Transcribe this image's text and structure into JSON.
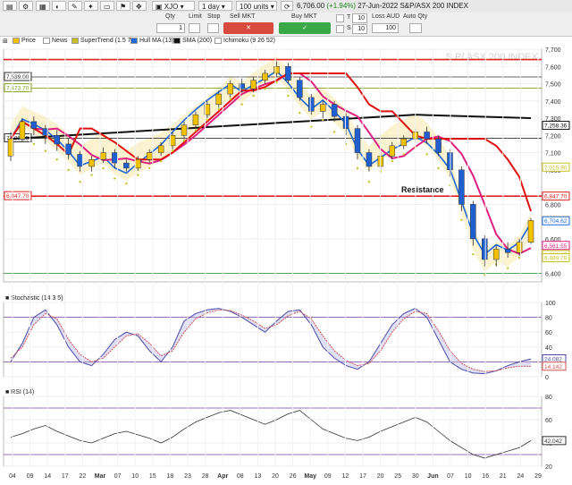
{
  "toolbar": {
    "symbol": "XJO",
    "period": "1 day",
    "units": "100 units",
    "last_price": "6,706.00",
    "change": "(+1.94%)",
    "date": "27-Jun-2022",
    "index_name": "S&P/ASX 200 INDEX"
  },
  "order_bar": {
    "qty_label": "Qty",
    "qty_value": "1",
    "limit_label": "Limit",
    "stop_label": "Stop",
    "sell_label": "Sell MKT",
    "buy_label": "Buy MKT",
    "t_label": "T",
    "s_label": "S",
    "t_value": "10",
    "s_value": "10",
    "loss_label": "Loss AUD",
    "loss_value": "100",
    "auto_qty_label": "Auto Qty"
  },
  "indicators_bar": {
    "items": [
      {
        "label": "Price",
        "color": "#f2c200"
      },
      {
        "label": "News",
        "color": "#ffffff"
      },
      {
        "label": "SuperTrend (1.5 7)",
        "color": "#c7c020"
      },
      {
        "label": "Hull MA (13)",
        "color": "#2068d8"
      },
      {
        "label": "SMA (200)",
        "color": "#111111"
      },
      {
        "label": "Ichimoku (9 26 52)",
        "color": "#ffffff"
      }
    ]
  },
  "chart_data": [
    {
      "type": "candlestick",
      "title": "S P/ ASX 200 INDEX",
      "ylim": [
        6350,
        7700
      ],
      "y_ticks": [
        6400,
        6600,
        6800,
        7000,
        7100,
        7200,
        7300,
        7400,
        7500,
        7600,
        7700
      ],
      "y_tick_labels": [
        "6,400",
        "6,600",
        "6,800",
        "7,000",
        "7,100",
        "7,200",
        "7,300",
        "7,400",
        "7,500",
        "7,600",
        "7,700"
      ],
      "x_ticks": [
        "04",
        "09",
        "14",
        "17",
        "22",
        "Mar",
        "07",
        "10",
        "15",
        "18",
        "23",
        "28",
        "Apr",
        "08",
        "13",
        "20",
        "26",
        "May",
        "09",
        "12",
        "17",
        "20",
        "25",
        "30",
        "Jun",
        "07",
        "10",
        "16",
        "21",
        "24",
        "29"
      ],
      "horizontal_levels": [
        {
          "value": 7640,
          "color": "#e02020",
          "label": ""
        },
        {
          "value": 7539.0,
          "color": "#333333",
          "label": "7,539.00"
        },
        {
          "value": 7473.7,
          "color": "#7fa020",
          "label": "7,473.70"
        },
        {
          "value": 7183.15,
          "color": "#333333",
          "label": "7,183.15"
        },
        {
          "value": 6847.7,
          "color": "#e02020",
          "label": "6,847.70"
        },
        {
          "value": 6400,
          "color": "#2a8a2a",
          "label": ""
        }
      ],
      "right_tags": [
        {
          "value": 7258.36,
          "label": "7,258.36",
          "color": "#111111"
        },
        {
          "value": 7015.9,
          "label": "7,015.90",
          "color": "#c7c020"
        },
        {
          "value": 6847.7,
          "label": "6,847.70",
          "color": "#e02020"
        },
        {
          "value": 6706.0,
          "label": "6,706.00",
          "color": "#f2c200"
        },
        {
          "value": 6704.62,
          "label": "6,704.62",
          "color": "#2068d8"
        },
        {
          "value": 6561.55,
          "label": "6,561.55",
          "color": "#e02080"
        },
        {
          "value": 6508.67,
          "label": "6,508.67",
          "color": "#c7c020"
        },
        {
          "value": 6489.79,
          "label": "6,489.79",
          "color": "#c7c020"
        }
      ],
      "annotation": "Resistance",
      "candles": [
        {
          "o": 7080,
          "c": 7180,
          "h": 7220,
          "l": 7050
        },
        {
          "o": 7180,
          "c": 7280,
          "h": 7300,
          "l": 7160
        },
        {
          "o": 7280,
          "c": 7240,
          "h": 7310,
          "l": 7200
        },
        {
          "o": 7240,
          "c": 7200,
          "h": 7260,
          "l": 7150
        },
        {
          "o": 7200,
          "c": 7150,
          "h": 7230,
          "l": 7110
        },
        {
          "o": 7150,
          "c": 7090,
          "h": 7180,
          "l": 7060
        },
        {
          "o": 7090,
          "c": 7020,
          "h": 7110,
          "l": 6990
        },
        {
          "o": 7020,
          "c": 7060,
          "h": 7080,
          "l": 6990
        },
        {
          "o": 7060,
          "c": 7100,
          "h": 7130,
          "l": 7040
        },
        {
          "o": 7100,
          "c": 7040,
          "h": 7120,
          "l": 7010
        },
        {
          "o": 7040,
          "c": 7010,
          "h": 7060,
          "l": 6990
        },
        {
          "o": 7010,
          "c": 7060,
          "h": 7080,
          "l": 6995
        },
        {
          "o": 7060,
          "c": 7100,
          "h": 7120,
          "l": 7040
        },
        {
          "o": 7100,
          "c": 7140,
          "h": 7160,
          "l": 7080
        },
        {
          "o": 7140,
          "c": 7200,
          "h": 7220,
          "l": 7120
        },
        {
          "o": 7200,
          "c": 7260,
          "h": 7280,
          "l": 7180
        },
        {
          "o": 7260,
          "c": 7320,
          "h": 7340,
          "l": 7240
        },
        {
          "o": 7320,
          "c": 7380,
          "h": 7400,
          "l": 7300
        },
        {
          "o": 7380,
          "c": 7440,
          "h": 7460,
          "l": 7360
        },
        {
          "o": 7440,
          "c": 7500,
          "h": 7520,
          "l": 7420
        },
        {
          "o": 7500,
          "c": 7470,
          "h": 7530,
          "l": 7450
        },
        {
          "o": 7470,
          "c": 7520,
          "h": 7540,
          "l": 7450
        },
        {
          "o": 7520,
          "c": 7560,
          "h": 7580,
          "l": 7500
        },
        {
          "o": 7560,
          "c": 7600,
          "h": 7630,
          "l": 7540
        },
        {
          "o": 7600,
          "c": 7520,
          "h": 7620,
          "l": 7500
        },
        {
          "o": 7520,
          "c": 7420,
          "h": 7540,
          "l": 7400
        },
        {
          "o": 7420,
          "c": 7340,
          "h": 7440,
          "l": 7320
        },
        {
          "o": 7340,
          "c": 7380,
          "h": 7400,
          "l": 7300
        },
        {
          "o": 7380,
          "c": 7310,
          "h": 7400,
          "l": 7280
        },
        {
          "o": 7310,
          "c": 7240,
          "h": 7330,
          "l": 7200
        },
        {
          "o": 7240,
          "c": 7100,
          "h": 7260,
          "l": 7060
        },
        {
          "o": 7100,
          "c": 7020,
          "h": 7120,
          "l": 6990
        },
        {
          "o": 7020,
          "c": 7080,
          "h": 7100,
          "l": 7000
        },
        {
          "o": 7080,
          "c": 7140,
          "h": 7160,
          "l": 7060
        },
        {
          "o": 7140,
          "c": 7180,
          "h": 7200,
          "l": 7120
        },
        {
          "o": 7180,
          "c": 7220,
          "h": 7240,
          "l": 7160
        },
        {
          "o": 7220,
          "c": 7180,
          "h": 7250,
          "l": 7150
        },
        {
          "o": 7180,
          "c": 7100,
          "h": 7200,
          "l": 7080
        },
        {
          "o": 7100,
          "c": 7000,
          "h": 7120,
          "l": 6960
        },
        {
          "o": 7000,
          "c": 6800,
          "h": 7020,
          "l": 6760
        },
        {
          "o": 6800,
          "c": 6600,
          "h": 6820,
          "l": 6560
        },
        {
          "o": 6600,
          "c": 6480,
          "h": 6620,
          "l": 6440
        },
        {
          "o": 6480,
          "c": 6540,
          "h": 6560,
          "l": 6440
        },
        {
          "o": 6540,
          "c": 6520,
          "h": 6580,
          "l": 6490
        },
        {
          "o": 6520,
          "c": 6580,
          "h": 6600,
          "l": 6500
        },
        {
          "o": 6580,
          "c": 6706,
          "h": 6720,
          "l": 6570
        }
      ]
    },
    {
      "type": "line",
      "title": "Stochastic (14 3 5)",
      "ylim": [
        0,
        100
      ],
      "y_ticks": [
        0,
        20,
        40,
        60,
        80,
        100
      ],
      "bands": [
        20,
        80
      ],
      "right_tags": [
        {
          "value": 24.082,
          "label": "24.082",
          "color": "#4b4ba8"
        },
        {
          "value": 14.142,
          "label": "14.142",
          "color": "#d05050"
        }
      ],
      "series": [
        {
          "values": [
            20,
            45,
            80,
            90,
            70,
            40,
            20,
            15,
            30,
            50,
            60,
            55,
            35,
            20,
            40,
            75,
            85,
            90,
            92,
            88,
            80,
            70,
            60,
            75,
            88,
            90,
            70,
            40,
            25,
            15,
            10,
            20,
            45,
            70,
            85,
            92,
            80,
            50,
            20,
            10,
            5,
            4,
            8,
            15,
            20,
            24
          ]
        },
        {
          "values": [
            25,
            40,
            70,
            85,
            78,
            50,
            30,
            20,
            25,
            40,
            55,
            58,
            45,
            28,
            35,
            60,
            78,
            86,
            90,
            89,
            83,
            75,
            65,
            70,
            82,
            88,
            78,
            55,
            35,
            22,
            15,
            18,
            35,
            60,
            78,
            88,
            85,
            62,
            35,
            18,
            10,
            7,
            8,
            12,
            14,
            14
          ]
        }
      ]
    },
    {
      "type": "line",
      "title": "RSI (14)",
      "ylim": [
        20,
        80
      ],
      "y_ticks": [
        20,
        40,
        60,
        80
      ],
      "bands": [
        30,
        70
      ],
      "right_tags": [
        {
          "value": 42.042,
          "label": "42.042",
          "color": "#333333"
        }
      ],
      "series": [
        {
          "values": [
            45,
            48,
            52,
            55,
            50,
            46,
            42,
            40,
            44,
            48,
            50,
            47,
            44,
            40,
            45,
            52,
            58,
            62,
            66,
            68,
            64,
            60,
            56,
            60,
            65,
            68,
            60,
            52,
            48,
            44,
            42,
            45,
            50,
            54,
            58,
            62,
            58,
            50,
            42,
            36,
            30,
            27,
            30,
            33,
            36,
            42
          ]
        }
      ]
    }
  ]
}
